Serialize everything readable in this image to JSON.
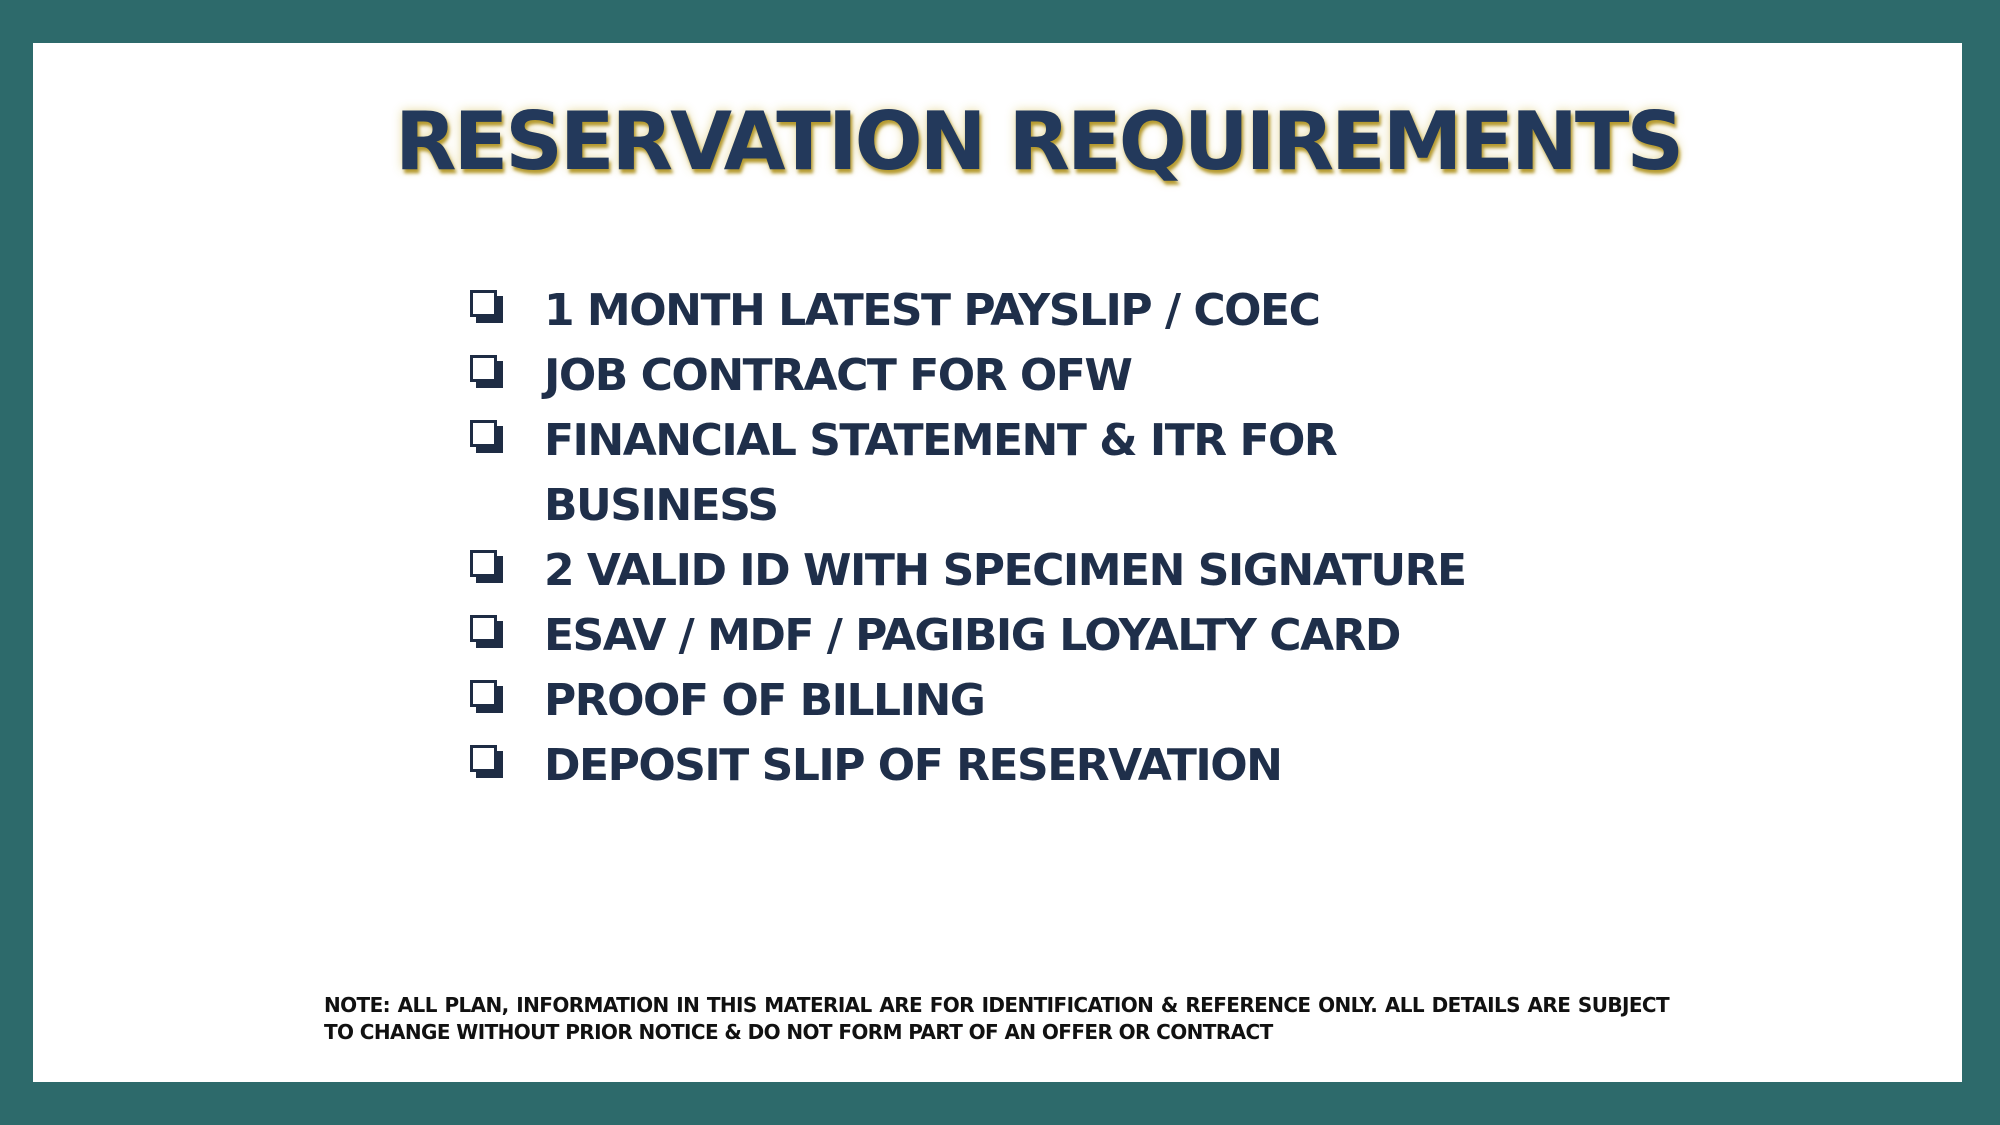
{
  "slide": {
    "title": "RESERVATION REQUIREMENTS",
    "requirements": [
      "1 MONTH LATEST PAYSLIP / COEC",
      "JOB CONTRACT FOR OFW",
      "FINANCIAL STATEMENT & ITR FOR",
      "BUSINESS",
      "2 VALID ID WITH SPECIMEN SIGNATURE",
      "ESAV / MDF / PAGIBIG LOYALTY CARD",
      "PROOF OF BILLING",
      "DEPOSIT SLIP OF RESERVATION"
    ],
    "note": "NOTE: ALL PLAN, INFORMATION IN THIS MATERIAL ARE FOR IDENTIFICATION & REFERENCE ONLY. ALL DETAILS ARE SUBJECT TO CHANGE WITHOUT PRIOR NOTICE & DO NOT FORM PART OF AN OFFER OR CONTRACT"
  },
  "colors": {
    "frame": "#2d6a6b",
    "title": "#23395b",
    "title_glow": "#aa8c14",
    "list_text": "#1f2f4a",
    "note_text": "#111111"
  },
  "icons": {
    "bullet": "checkbox-icon"
  }
}
